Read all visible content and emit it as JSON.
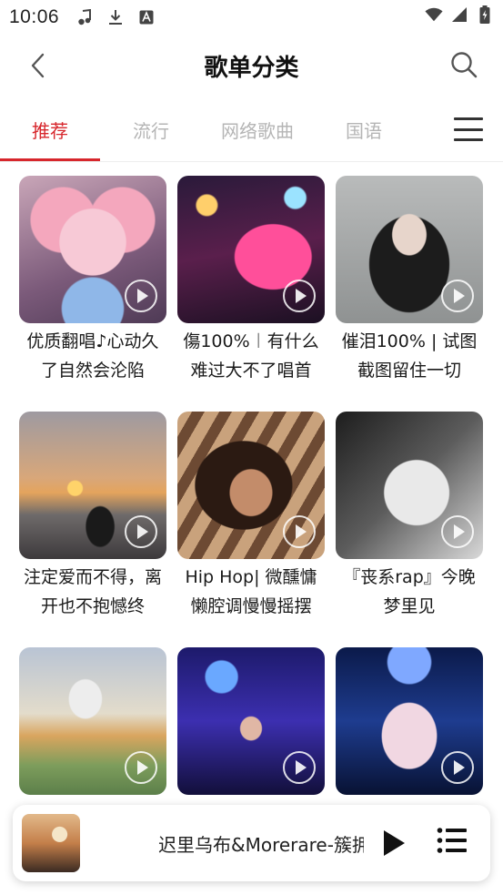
{
  "status_bar": {
    "time": "10:06",
    "left_icons": [
      "music-note-icon",
      "download-icon",
      "a-badge-icon"
    ],
    "right_icons": [
      "wifi-icon",
      "signal-icon",
      "battery-icon"
    ]
  },
  "header": {
    "title": "歌单分类",
    "back_icon": "chevron-left-icon",
    "search_icon": "search-icon"
  },
  "tabs": {
    "items": [
      {
        "label": "推荐",
        "active": true
      },
      {
        "label": "流行",
        "active": false
      },
      {
        "label": "网络歌曲",
        "active": false
      },
      {
        "label": "国语",
        "active": false
      }
    ],
    "menu_icon": "hamburger-menu-icon",
    "accent_color": "#d7262c"
  },
  "playlists": [
    {
      "title": "优质翻唱♪心动久了自然会沦陷"
    },
    {
      "title": "傷100%︱有什么难过大不了唱首"
    },
    {
      "title": "催泪100% | 试图截图留住一切"
    },
    {
      "title": "注定爱而不得，离开也不抱憾终"
    },
    {
      "title": "Hip Hop| 微醺慵懒腔调慢慢摇摆"
    },
    {
      "title": "『丧系rap』今晚梦里见"
    },
    {
      "title": ""
    },
    {
      "title": ""
    },
    {
      "title": ""
    }
  ],
  "mini_player": {
    "track": "迟里乌布&Morerare-簇拥",
    "play_icon": "play-icon",
    "playlist_icon": "playlist-icon"
  }
}
